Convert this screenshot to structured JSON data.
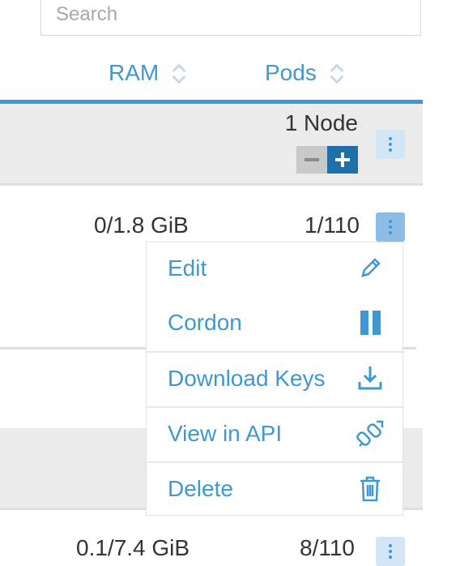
{
  "search": {
    "placeholder": "Search",
    "value": ""
  },
  "columns": {
    "ram": "RAM",
    "pods": "Pods"
  },
  "group": {
    "node_count": "1 Node"
  },
  "rows": [
    {
      "ram": "0/1.8 GiB",
      "pods": "1/110"
    },
    {
      "ram": "0.1/7.4 GiB",
      "pods": "8/110"
    }
  ],
  "menu": {
    "items": [
      {
        "label": "Edit",
        "icon": "pencil-icon"
      },
      {
        "label": "Cordon",
        "icon": "pause-icon"
      },
      {
        "label": "Download Keys",
        "icon": "download-icon"
      },
      {
        "label": "View in API",
        "icon": "external-link-icon"
      },
      {
        "label": "Delete",
        "icon": "trash-icon"
      }
    ]
  },
  "colors": {
    "accent": "#3d98d3",
    "dark_accent": "#1f6fa8",
    "band": "#ebebeb"
  }
}
